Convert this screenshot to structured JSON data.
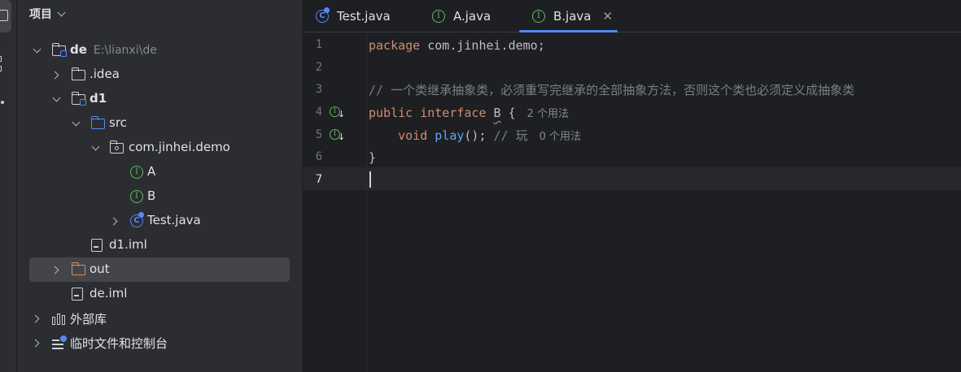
{
  "project_panel": {
    "title": "项目",
    "tree": [
      {
        "label": "de",
        "path": "E:\\lianxi\\de"
      },
      {
        "label": ".idea"
      },
      {
        "label": "d1"
      },
      {
        "label": "src"
      },
      {
        "label": "com.jinhei.demo"
      },
      {
        "label": "A"
      },
      {
        "label": "B"
      },
      {
        "label": "Test.java"
      },
      {
        "label": "d1.iml"
      },
      {
        "label": "out"
      },
      {
        "label": "de.iml"
      },
      {
        "label": "外部库"
      },
      {
        "label": "临时文件和控制台"
      }
    ]
  },
  "tabs": [
    {
      "label": "Test.java"
    },
    {
      "label": "A.java"
    },
    {
      "label": "B.java",
      "active": true
    }
  ],
  "editor": {
    "line_numbers": [
      "1",
      "2",
      "3",
      "4",
      "5",
      "6",
      "7"
    ],
    "active_line": "7",
    "lines": {
      "l1_kw": "package",
      "l1_rest": " com.jinhei.demo;",
      "l3_comment": "// 一个类继承抽象类，必须重写完继承的全部抽象方法，否则这个类也必须定义成抽象类",
      "l4_kw1": "public",
      "l4_kw2": "interface",
      "l4_name": "B",
      "l4_brace": " {",
      "l4_hint": "2 个用法",
      "l5_kw": "void",
      "l5_fn": "play",
      "l5_rest": "();",
      "l5_comment": "// 玩",
      "l5_hint": "0 个用法",
      "l6_brace": "}"
    }
  },
  "colors": {
    "accent": "#548af7",
    "keyword": "#cf8e6d",
    "comment": "#7a7e85",
    "function": "#56a8f5",
    "interface_icon": "#5fb865"
  }
}
